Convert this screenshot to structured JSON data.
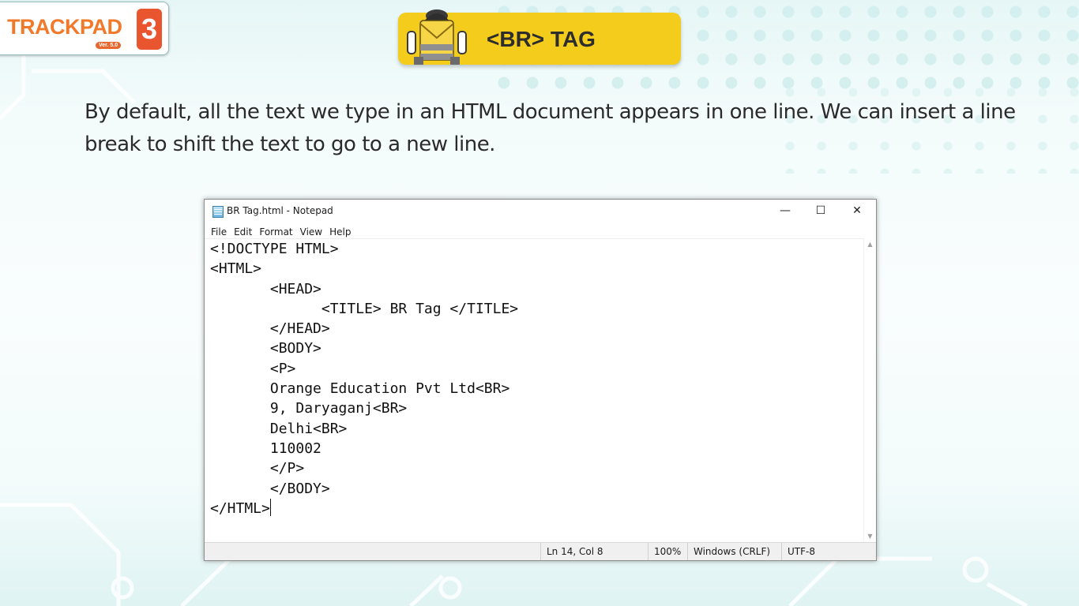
{
  "logo": {
    "text": "TRACKPAD",
    "version": "Ver. 5.0",
    "badge": "3"
  },
  "banner": {
    "title": "<BR> TAG"
  },
  "intro": "By default, all the text we type in an HTML document appears in one line. We can insert a line break to shift the text to go to a new line.",
  "window": {
    "title": "BR Tag.html - Notepad",
    "controls": {
      "minimize": "—",
      "maximize": "☐",
      "close": "✕"
    },
    "menu": [
      "File",
      "Edit",
      "Format",
      "View",
      "Help"
    ],
    "code_lines": [
      "<!DOCTYPE HTML>",
      "<HTML>",
      "       <HEAD>",
      "             <TITLE> BR Tag </TITLE>",
      "       </HEAD>",
      "       <BODY>",
      "       <P>",
      "       Orange Education Pvt Ltd<BR>",
      "       9, Daryaganj<BR>",
      "       Delhi<BR>",
      "       110002",
      "       </P>",
      "       </BODY>",
      "</HTML>"
    ],
    "status": {
      "position": "Ln 14, Col 8",
      "zoom": "100%",
      "line_ending": "Windows (CRLF)",
      "encoding": "UTF-8"
    }
  }
}
